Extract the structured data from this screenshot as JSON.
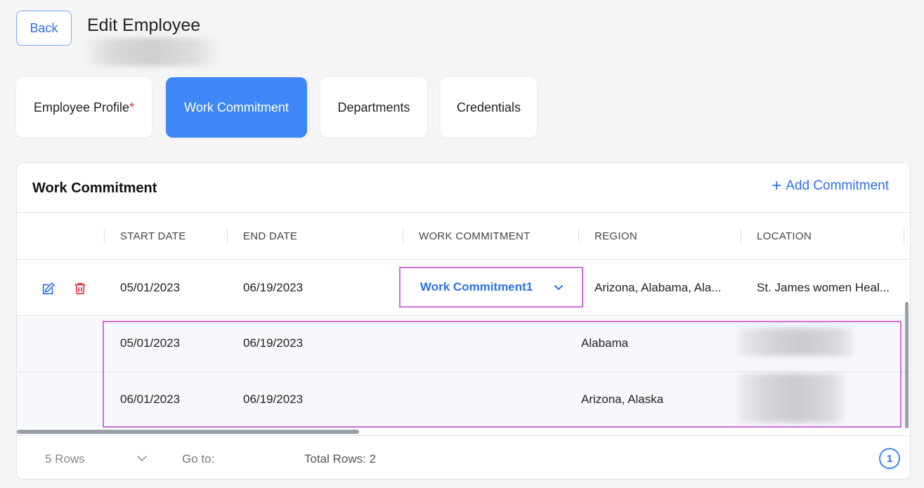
{
  "header": {
    "back_label": "Back",
    "title": "Edit Employee"
  },
  "tabs": [
    {
      "label": "Employee Profile",
      "required_mark": "*",
      "active": false
    },
    {
      "label": "Work Commitment",
      "active": true
    },
    {
      "label": "Departments",
      "active": false
    },
    {
      "label": "Credentials",
      "active": false
    }
  ],
  "card": {
    "title": "Work Commitment",
    "add_label": "Add Commitment",
    "add_icon": "plus-icon"
  },
  "table": {
    "columns": [
      "START DATE",
      "END DATE",
      "WORK COMMITMENT",
      "REGION",
      "LOCATION"
    ],
    "row": {
      "start_date": "05/01/2023",
      "end_date": "06/19/2023",
      "work_commitment": "Work Commitment1",
      "region": "Arizona, Alabama, Ala...",
      "location": "St. James women Heal...",
      "edit_icon": "pencil-square-icon",
      "delete_icon": "trash-icon"
    },
    "sub_rows": [
      {
        "start_date": "05/01/2023",
        "end_date": "06/19/2023",
        "region": "Alabama"
      },
      {
        "start_date": "06/01/2023",
        "end_date": "06/19/2023",
        "region": "Arizona, Alaska"
      }
    ]
  },
  "footer": {
    "rows_per_page": "5 Rows",
    "goto_label": "Go to:",
    "total_rows": "Total Rows: 2",
    "current_page": "1"
  },
  "colors": {
    "accent": "#3f86f7",
    "link": "#2f6fe8",
    "highlight": "#d36be0",
    "danger": "#e0303a"
  }
}
